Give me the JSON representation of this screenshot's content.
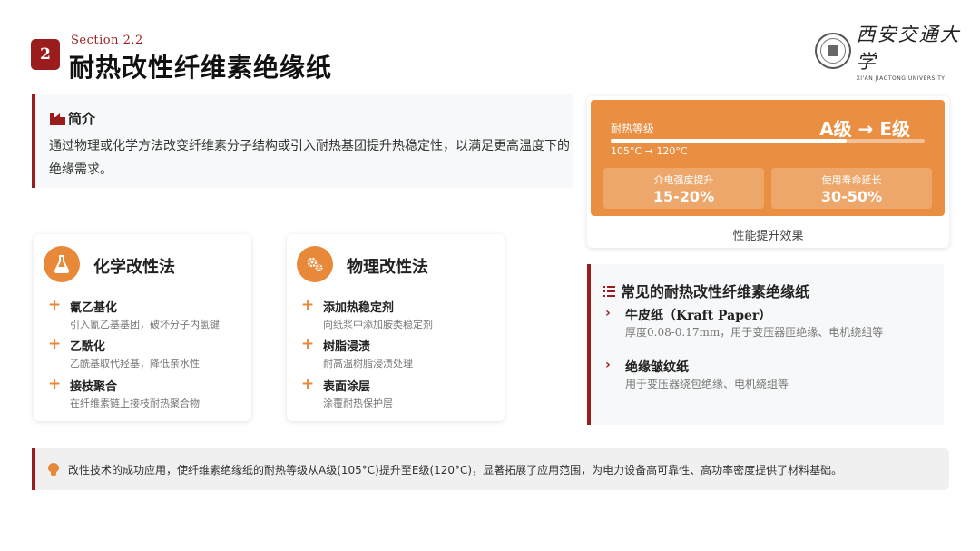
{
  "header": {
    "section_number": "2",
    "section_label": "Section 2.2",
    "title": "耐热改性纤维素绝缘纸",
    "logo_cn": "西安交通大学",
    "logo_en": "XI'AN JIAOTONG UNIVERSITY"
  },
  "intro": {
    "icon": "factory-icon",
    "title": "简介",
    "text": "通过物理或化学方法改变纤维素分子结构或引入耐热基团提升热稳定性，以满足更高温度下的绝缘需求。"
  },
  "chemical": {
    "icon": "flask-icon",
    "title": "化学改性法",
    "items": [
      {
        "name": "氰乙基化",
        "desc": "引入氰乙基基团，破坏分子内氢键"
      },
      {
        "name": "乙酰化",
        "desc": "乙酰基取代羟基，降低亲水性"
      },
      {
        "name": "接枝聚合",
        "desc": "在纤维素链上接枝耐热聚合物"
      }
    ]
  },
  "physical": {
    "icon": "gears-icon",
    "title": "物理改性法",
    "items": [
      {
        "name": "添加热稳定剂",
        "desc": "向纸浆中添加胺类稳定剂"
      },
      {
        "name": "树脂浸渍",
        "desc": "耐高温树脂浸渍处理"
      },
      {
        "name": "表面涂层",
        "desc": "涂覆耐热保护层"
      }
    ]
  },
  "performance": {
    "label": "耐热等级",
    "grade": "A级 → E级",
    "progress": 0.75,
    "range": "105°C → 120°C",
    "stats": [
      {
        "label": "介电强度提升",
        "value": "15-20%"
      },
      {
        "label": "使用寿命延长",
        "value": "30-50%"
      }
    ],
    "caption": "性能提升效果"
  },
  "common": {
    "title": "常见的耐热改性纤维素绝缘纸",
    "papers": [
      {
        "name": "牛皮纸（Kraft Paper）",
        "desc": "厚度0.08-0.17mm，用于变压器匝绝缘、电机绕组等"
      },
      {
        "name": "绝缘皱纹纸",
        "desc": "用于变压器绕包绝缘、电机绕组等"
      }
    ]
  },
  "note": {
    "icon": "lightbulb-icon",
    "text": "改性技术的成功应用，使纤维素绝缘纸的耐热等级从A级(105°C)提升至E级(120°C)，显著拓展了应用范围，为电力设备高可靠性、高功率密度提供了材料基础。"
  },
  "colors": {
    "accent": "#9b1c1c",
    "orange": "#ea8f42"
  }
}
